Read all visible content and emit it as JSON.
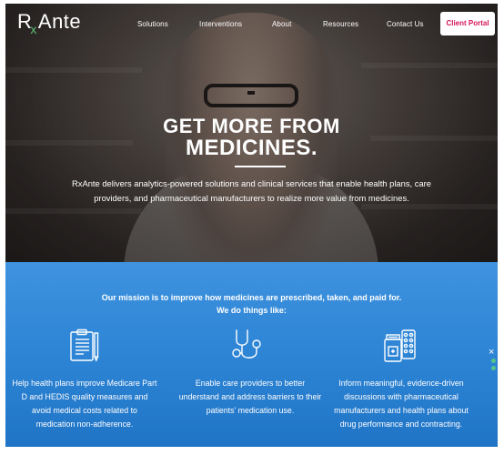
{
  "brand": {
    "logo_text_left": "R",
    "logo_text_x": "x",
    "logo_text_right": "Ante"
  },
  "nav": {
    "items": [
      "Solutions",
      "Interventions",
      "About",
      "Resources",
      "Contact Us"
    ],
    "client_portal": "Client Portal"
  },
  "hero": {
    "headline_line1": "GET MORE FROM",
    "headline_line2": "MEDICINES.",
    "description": "RxAnte delivers analytics-powered solutions and clinical services that enable health plans, care providers, and pharmaceutical manufacturers to realize more value from medicines."
  },
  "mission": {
    "intro": "Our mission is to improve how medicines are prescribed, taken, and paid for. We do things like:",
    "columns": [
      {
        "icon": "clipboard-icon",
        "text": "Help health plans improve Medicare Part D and HEDIS quality measures and avoid medical costs related to medication non-adherence."
      },
      {
        "icon": "stethoscope-icon",
        "text": "Enable care providers to better understand and address barriers to their patients' medication use."
      },
      {
        "icon": "pills-bottle-icon",
        "text": "Inform meaningful, evidence-driven discussions with pharmaceutical manufacturers and health plans about drug performance and contracting."
      }
    ]
  },
  "side_nav": {
    "close_glyph": "×"
  },
  "colors": {
    "accent_blue": "#2f86d6",
    "portal_pink": "#d4145a",
    "dot_green": "#53c48a"
  }
}
